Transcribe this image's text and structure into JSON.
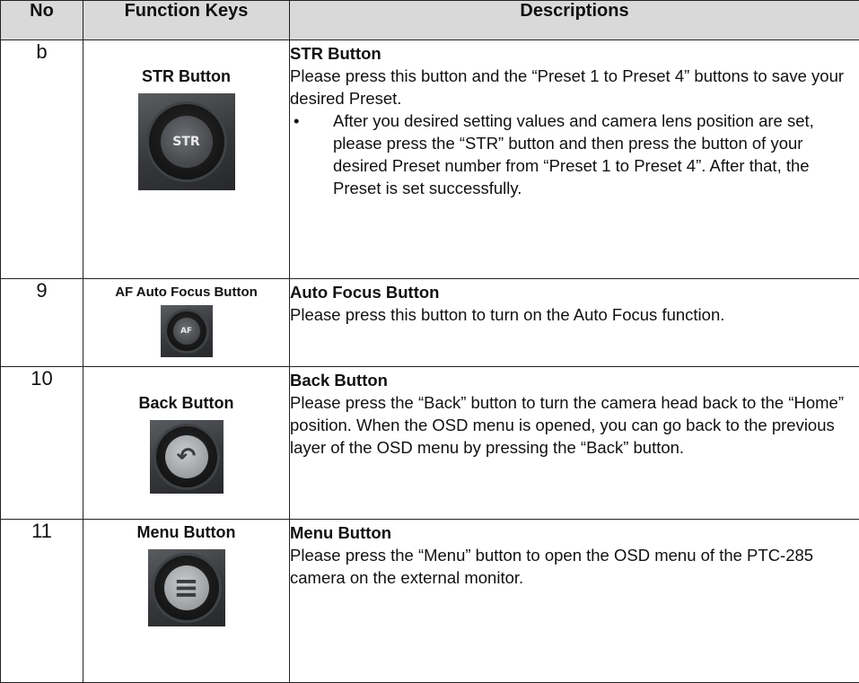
{
  "header": {
    "no": "No",
    "function_keys": "Function Keys",
    "descriptions": "Descriptions"
  },
  "rows": [
    {
      "no": "b",
      "key_label": "STR Button",
      "key_icon": "str-button",
      "key_cap_text": "STR",
      "desc_title": "STR Button",
      "desc_text": "Please press this button and the “Preset 1 to Preset 4” buttons to save your desired Preset.",
      "bullet": "•",
      "bullet_text": "After you desired setting values and camera lens position are set, please press the “STR” button and then press the button of your desired Preset number from “Preset 1 to Preset 4”. After that, the Preset is set successfully."
    },
    {
      "no": "9",
      "key_label": "AF Auto Focus Button",
      "key_icon": "af-button",
      "key_cap_text": "AF",
      "desc_title": "Auto Focus Button",
      "desc_text": "Please press this button to turn on the Auto Focus function."
    },
    {
      "no": "10",
      "key_label": "Back Button",
      "key_icon": "back-arrow",
      "key_cap_text": "↶",
      "desc_title": "Back Button",
      "desc_text": "Please press the “Back” button to turn the camera head back to the “Home” position. When the OSD menu is opened, you can go back to the previous layer of the OSD menu by pressing the “Back” button."
    },
    {
      "no": "11",
      "key_label": "Menu Button",
      "key_icon": "menu-lines",
      "key_cap_text": "≡",
      "desc_title": "Menu Button",
      "desc_text": "Please press the “Menu” button to open the OSD menu of the PTC-285 camera on the external monitor."
    }
  ]
}
